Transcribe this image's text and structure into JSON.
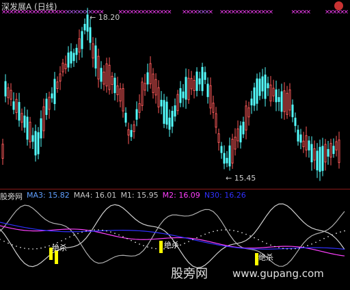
{
  "title": "深发展A (日线)",
  "price_high_label": "18.20",
  "price_low_label": "15.45",
  "indicator_name": "股旁网",
  "indicator_values": {
    "ma3": "MA3: 15.82",
    "ma4": "MA4: 16.01",
    "m1": "M1: 15.95",
    "m2": "M2: 16.09",
    "n30": "N30: 16.26"
  },
  "signals": [
    "绝杀",
    "绝杀",
    "绝杀"
  ],
  "watermark": "股旁网",
  "watermark_url": "www.gupang.com",
  "colors": {
    "up": "#ff5a5a",
    "down": "#54ffff",
    "magenta": "#ff40ff",
    "ma3": "#60a0ff",
    "ma4": "#d8d8d8",
    "m1": "#d8d8d8",
    "m2": "#ff40ff",
    "n30": "#3030ff",
    "signal_bar": "#ffff00",
    "separator": "#8a1b1b"
  }
}
